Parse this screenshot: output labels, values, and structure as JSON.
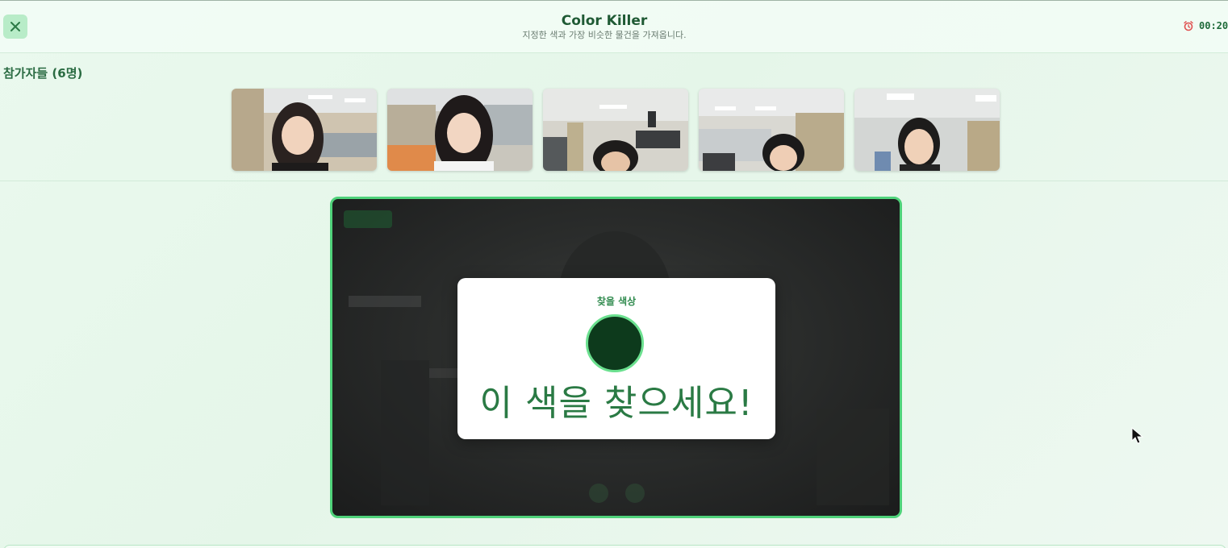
{
  "header": {
    "title": "Color Killer",
    "subtitle": "지정한 색과 가장 비슷한 물건을 가져옵니다.",
    "timer": "00:20",
    "close_icon": "close-icon",
    "timer_icon": "alarm-clock-icon"
  },
  "participants": {
    "title": "참가자들 (6명)",
    "count_visible_tiles": 5
  },
  "target": {
    "label": "찾을 색상",
    "headline": "이 색을 찾으세요!",
    "color": "#0d3a1c"
  },
  "colors": {
    "accent": "#4fd27a",
    "brand_text": "#1f5a34",
    "close_button_bg": "#b8ecc8"
  }
}
